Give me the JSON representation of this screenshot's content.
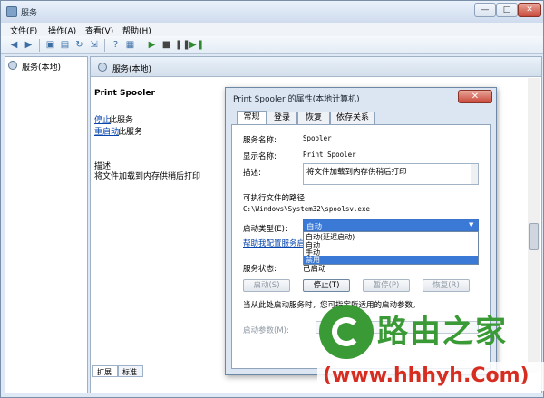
{
  "window": {
    "title": "服务",
    "buttons": {
      "minimize": "—",
      "maximize": "□",
      "close": "✕"
    }
  },
  "menu": [
    "文件(F)",
    "操作(A)",
    "查看(V)",
    "帮助(H)"
  ],
  "toolbar": {
    "icons": [
      "back-icon",
      "forward-icon",
      "console-tree-icon",
      "properties-icon",
      "refresh-icon",
      "export-icon",
      "help-icon",
      "show-hide-icon",
      "start-icon",
      "stop-icon",
      "pause-icon",
      "restart-icon"
    ]
  },
  "tree": {
    "root_label": "服务(本地)"
  },
  "right": {
    "header": "服务(本地)",
    "detail_title": "Print Spooler",
    "stop_link": "停止",
    "stop_suffix": "此服务",
    "restart_link": "重启动",
    "restart_suffix": "此服务",
    "desc_label": "描述:",
    "desc_text": "将文件加载到内存供稍后打印",
    "tabs": [
      "扩展",
      "标准"
    ]
  },
  "dialog": {
    "title": "Print Spooler 的属性(本地计算机)",
    "close": "✕",
    "tabs": [
      "常规",
      "登录",
      "恢复",
      "依存关系"
    ],
    "service_name_label": "服务名称:",
    "service_name": "Spooler",
    "display_name_label": "显示名称:",
    "display_name": "Print Spooler",
    "description_label": "描述:",
    "description": "将文件加载到内存供稍后打印",
    "path_label": "可执行文件的路径:",
    "path": "C:\\Windows\\System32\\spoolsv.exe",
    "startup_type_label": "启动类型(E):",
    "startup_type_value": "自动",
    "startup_options": [
      "自动(延迟启动)",
      "自动",
      "手动",
      "禁用"
    ],
    "help_link": "帮助我配置服务启动",
    "status_label": "服务状态:",
    "status_value": "已启动",
    "buttons": {
      "start": "启动(S)",
      "stop": "停止(T)",
      "pause": "暂停(P)",
      "resume": "恢复(R)"
    },
    "hint": "当从此处启动服务时，您可指定所适用的启动参数。",
    "params_label": "启动参数(M):"
  },
  "watermark": {
    "brand": "路由之家",
    "url": "(www.hhhyh.Com)"
  },
  "colors": {
    "accent": "#3a79d6",
    "brand_green": "#3a9a35",
    "url_red": "#d62d20"
  }
}
